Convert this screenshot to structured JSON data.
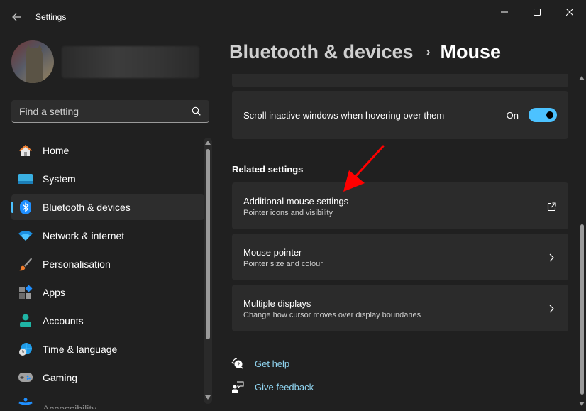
{
  "window": {
    "title": "Settings",
    "controls": {
      "minimize": "minimize-icon",
      "maximize": "maximize-icon",
      "close": "close-icon"
    }
  },
  "search": {
    "placeholder": "Find a setting",
    "value": ""
  },
  "sidebar": {
    "items": [
      {
        "label": "Home",
        "icon": "home-icon",
        "active": false
      },
      {
        "label": "System",
        "icon": "system-icon",
        "active": false
      },
      {
        "label": "Bluetooth & devices",
        "icon": "bluetooth-icon",
        "active": true
      },
      {
        "label": "Network & internet",
        "icon": "wifi-icon",
        "active": false
      },
      {
        "label": "Personalisation",
        "icon": "brush-icon",
        "active": false
      },
      {
        "label": "Apps",
        "icon": "apps-icon",
        "active": false
      },
      {
        "label": "Accounts",
        "icon": "account-icon",
        "active": false
      },
      {
        "label": "Time & language",
        "icon": "globe-clock-icon",
        "active": false
      },
      {
        "label": "Gaming",
        "icon": "gamepad-icon",
        "active": false
      },
      {
        "label": "Accessibility",
        "icon": "accessibility-icon",
        "active": false
      }
    ]
  },
  "header": {
    "breadcrumb_parent": "Bluetooth & devices",
    "breadcrumb_separator": "›",
    "breadcrumb_current": "Mouse"
  },
  "settings": {
    "scroll_inactive": {
      "label": "Scroll inactive windows when hovering over them",
      "state_label": "On",
      "enabled": true
    }
  },
  "related": {
    "title": "Related settings",
    "items": [
      {
        "title": "Additional mouse settings",
        "subtitle": "Pointer icons and visibility",
        "icon": "external-link-icon"
      },
      {
        "title": "Mouse pointer",
        "subtitle": "Pointer size and colour",
        "icon": "chevron-right-icon"
      },
      {
        "title": "Multiple displays",
        "subtitle": "Change how cursor moves over display boundaries",
        "icon": "chevron-right-icon"
      }
    ]
  },
  "help": {
    "get_help": "Get help",
    "give_feedback": "Give feedback"
  },
  "colors": {
    "accent": "#4cc2ff",
    "background": "#202020",
    "card": "#2b2b2b",
    "link": "#8fd3ef",
    "annotation": "#ff0000"
  }
}
